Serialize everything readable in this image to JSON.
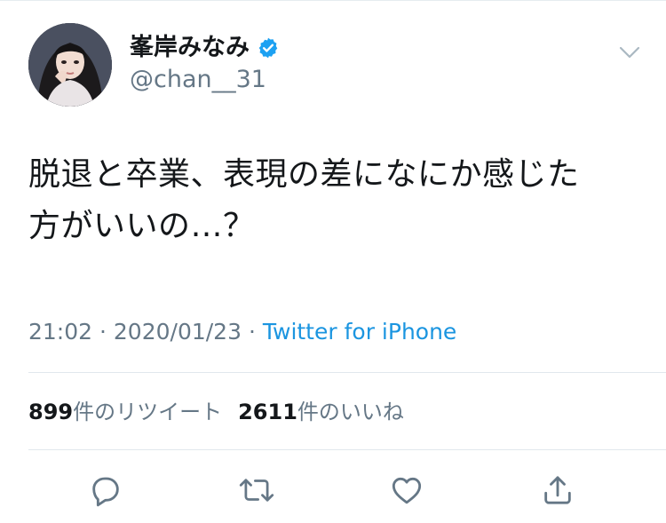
{
  "author": {
    "display_name": "峯岸みなみ",
    "handle": "@chan__31",
    "verified": true,
    "avatar_icon": "profile-photo"
  },
  "tweet": {
    "text": "脱退と卒業、表現の差になにか感じた方がいいの…？",
    "line1": "脱退と卒業、表現の差になにか感じた",
    "line2": "方がいいの…？"
  },
  "meta": {
    "time": "21:02",
    "separator": "·",
    "date": "2020/01/23",
    "source": "Twitter for iPhone"
  },
  "stats": {
    "retweets_count": "899",
    "retweets_label": "件のリツイート",
    "likes_count": "2611",
    "likes_label": "件のいいね"
  },
  "actions": [
    {
      "name": "reply",
      "icon": "reply-icon"
    },
    {
      "name": "retweet",
      "icon": "retweet-icon"
    },
    {
      "name": "like",
      "icon": "heart-icon"
    },
    {
      "name": "share",
      "icon": "share-icon"
    }
  ],
  "colors": {
    "link": "#1b95e0",
    "secondary_text": "#657786",
    "verified_badge": "#1da1f2",
    "icon_gray": "#657786",
    "divider": "#e1e8ed"
  }
}
